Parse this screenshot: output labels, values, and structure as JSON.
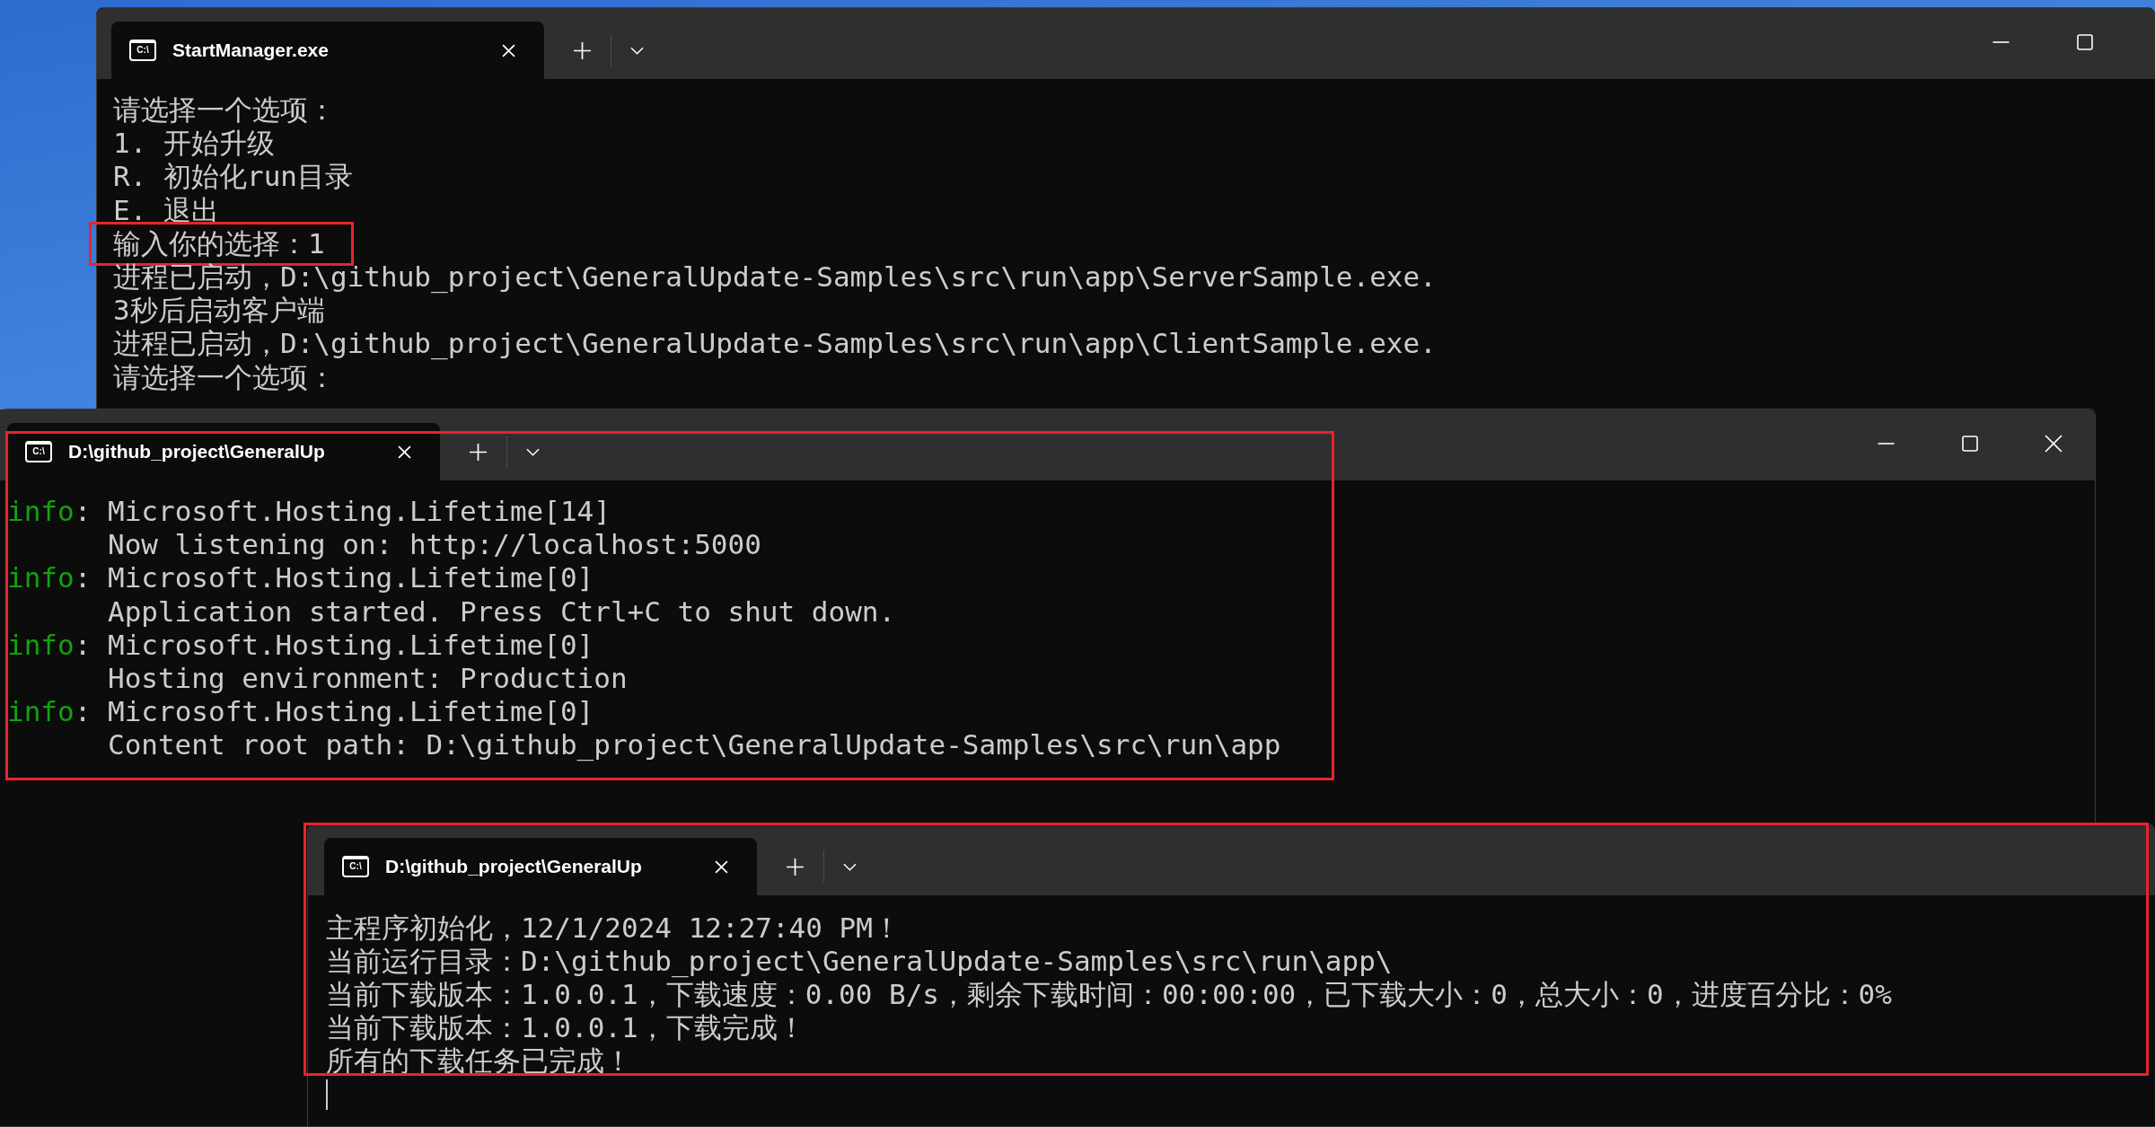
{
  "windows": [
    {
      "highlighted": false,
      "tabs": [
        {
          "title": "StartManager.exe",
          "icon_label": "C:\\",
          "selected": true
        }
      ],
      "lines": [
        {
          "kind": "text",
          "text": "请选择一个选项：",
          "highlighted": false
        },
        {
          "kind": "text",
          "text": "1. 开始升级",
          "highlighted": false
        },
        {
          "kind": "text",
          "text": "R. 初始化run目录",
          "highlighted": false
        },
        {
          "kind": "text",
          "text": "E. 退出",
          "highlighted": false
        },
        {
          "kind": "text",
          "text": "输入你的选择：1",
          "highlighted": true
        },
        {
          "kind": "text",
          "text": "进程已启动，D:\\github_project\\GeneralUpdate-Samples\\src\\run\\app\\ServerSample.exe.",
          "highlighted": false
        },
        {
          "kind": "text",
          "text": "3秒后启动客户端",
          "highlighted": false
        },
        {
          "kind": "text",
          "text": "进程已启动，D:\\github_project\\GeneralUpdate-Samples\\src\\run\\app\\ClientSample.exe.",
          "highlighted": false
        },
        {
          "kind": "text",
          "text": "请选择一个选项：",
          "highlighted": false
        }
      ]
    },
    {
      "highlighted": true,
      "tabs": [
        {
          "title": "D:\\github_project\\GeneralUp",
          "icon_label": "C:\\",
          "selected": true
        }
      ],
      "lines": [
        {
          "kind": "log",
          "tag": "info",
          "separator": ":",
          "text": "Microsoft.Hosting.Lifetime[14]"
        },
        {
          "kind": "detail",
          "text": "Now listening on: http://localhost:5000"
        },
        {
          "kind": "log",
          "tag": "info",
          "separator": ":",
          "text": "Microsoft.Hosting.Lifetime[0]"
        },
        {
          "kind": "detail",
          "text": "Application started. Press Ctrl+C to shut down."
        },
        {
          "kind": "log",
          "tag": "info",
          "separator": ":",
          "text": "Microsoft.Hosting.Lifetime[0]"
        },
        {
          "kind": "detail",
          "text": "Hosting environment: Production"
        },
        {
          "kind": "log",
          "tag": "info",
          "separator": ":",
          "text": "Microsoft.Hosting.Lifetime[0]"
        },
        {
          "kind": "detail",
          "text": "Content root path: D:\\github_project\\GeneralUpdate-Samples\\src\\run\\app"
        }
      ]
    },
    {
      "highlighted": true,
      "cursor": true,
      "tabs": [
        {
          "title": "D:\\github_project\\GeneralUp",
          "icon_label": "C:\\",
          "selected": true
        }
      ],
      "lines": [
        {
          "kind": "text",
          "text": "主程序初始化，12/1/2024 12:27:40 PM！"
        },
        {
          "kind": "text",
          "text": "当前运行目录：D:\\github_project\\GeneralUpdate-Samples\\src\\run\\app\\"
        },
        {
          "kind": "text",
          "text": "当前下载版本：1.0.0.1，下载速度：0.00 B/s，剩余下载时间：00:00:00，已下载大小：0，总大小：0，进度百分比：0%"
        },
        {
          "kind": "text",
          "text": "当前下载版本：1.0.0.1，下载完成！"
        },
        {
          "kind": "text",
          "text": "所有的下载任务已完成！"
        }
      ]
    }
  ]
}
